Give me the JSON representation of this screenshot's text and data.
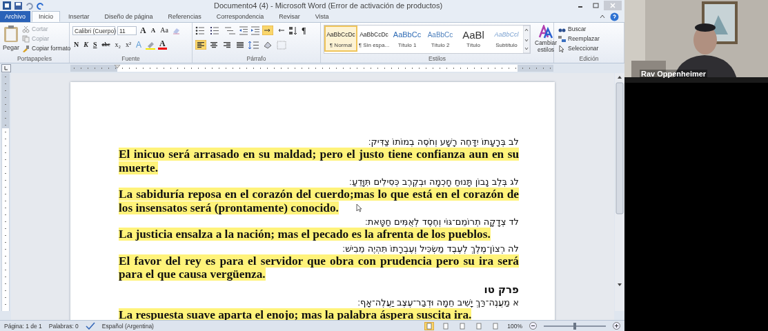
{
  "window": {
    "title": "Documento4 (4)  -  Microsoft Word (Error de activación de productos)"
  },
  "tabs": [
    {
      "label": "Archivo",
      "kind": "file",
      "selected": false
    },
    {
      "label": "Inicio",
      "kind": "tab",
      "selected": true
    },
    {
      "label": "Insertar",
      "kind": "tab",
      "selected": false
    },
    {
      "label": "Diseño de página",
      "kind": "tab",
      "selected": false
    },
    {
      "label": "Referencias",
      "kind": "tab",
      "selected": false
    },
    {
      "label": "Correspondencia",
      "kind": "tab",
      "selected": false
    },
    {
      "label": "Revisar",
      "kind": "tab",
      "selected": false
    },
    {
      "label": "Vista",
      "kind": "tab",
      "selected": false
    }
  ],
  "clipboard": {
    "label": "Portapapeles",
    "paste": "Pegar",
    "items": [
      {
        "label": "Cortar",
        "kind": "cut",
        "disabled": true
      },
      {
        "label": "Copiar",
        "kind": "copy",
        "disabled": true
      },
      {
        "label": "Copiar formato",
        "kind": "brush",
        "disabled": false
      }
    ]
  },
  "font": {
    "label": "Fuente",
    "name": "Calibri (Cuerpo)",
    "size": "11",
    "size_buttons": [
      {
        "label": "A",
        "kind": "grow"
      },
      {
        "label": "A",
        "kind": "shrink"
      },
      {
        "label": "Aa",
        "kind": "case"
      }
    ],
    "format_buttons": [
      {
        "label": "N",
        "kind": "bold"
      },
      {
        "label": "K",
        "kind": "italic"
      },
      {
        "label": "S",
        "kind": "underline"
      },
      {
        "label": "abc",
        "kind": "strike"
      },
      {
        "label": "x₂",
        "kind": "sub"
      },
      {
        "label": "x²",
        "kind": "sup"
      }
    ],
    "color_buttons": [
      {
        "label": "A",
        "kind": "effects"
      },
      {
        "label": "A",
        "kind": "color"
      }
    ]
  },
  "paragraph": {
    "label": "Párrafo",
    "directions": [
      {
        "kind": "ltr",
        "selected": true
      },
      {
        "kind": "rtl",
        "selected": false
      }
    ],
    "marks": {
      "label": "¶",
      "selected": false
    },
    "alignments": [
      {
        "kind": "left",
        "selected": true
      },
      {
        "kind": "center",
        "selected": false
      },
      {
        "kind": "right",
        "selected": false
      },
      {
        "kind": "justify",
        "selected": false
      }
    ]
  },
  "styles": {
    "label": "Estilos",
    "change": "Cambiar estilos",
    "items": [
      {
        "preview": "AaBbCcDc",
        "label": "¶ Normal",
        "kind": "normal",
        "selected": true
      },
      {
        "preview": "AaBbCcDc",
        "label": "¶ Sin espa...",
        "kind": "normal",
        "selected": false
      },
      {
        "preview": "AaBbCc",
        "label": "Título 1",
        "kind": "heading1",
        "selected": false
      },
      {
        "preview": "AaBbCc",
        "label": "Título 2",
        "kind": "heading2",
        "selected": false
      },
      {
        "preview": "AaBl",
        "label": "Título",
        "kind": "title",
        "selected": false
      },
      {
        "preview": "AaBbCcl",
        "label": "Subtítulo",
        "kind": "subtitle",
        "selected": false
      }
    ]
  },
  "editing": {
    "label": "Edición",
    "items": [
      {
        "label": "Buscar",
        "kind": "find"
      },
      {
        "label": "Reemplazar",
        "kind": "replace"
      },
      {
        "label": "Seleccionar",
        "kind": "select"
      }
    ]
  },
  "document": {
    "paragraphs": [
      {
        "kind": "hebrew",
        "text": "לב בְּרָעָתוֹ יִדָּחֶה רָשָׁע וְחֹסֶה בְמוֹתוֹ צַדִּיק׃"
      },
      {
        "kind": "spanish",
        "highlighted": true,
        "text": "El inicuo será arrasado en su maldad; pero el justo tiene confianza aun en su muerte."
      },
      {
        "kind": "hebrew",
        "text": "לג בְּלֵב נָבוֹן תָּנוּחַ חָכְמָה וּבְקֶרֶב כְּסִילִים תִּוָּדֵעַ׃"
      },
      {
        "kind": "spanish",
        "highlighted": true,
        "text": "La sabiduría reposa en el corazón del cuerdo;mas lo que está en el corazón de los insensatos será (prontamente)  conocido."
      },
      {
        "kind": "hebrew",
        "text": "לד צְדָקָה תְרוֹמֵם־גּוֹי וְחֶסֶד לְאֻמִּים חַטָּאת׃"
      },
      {
        "kind": "spanish",
        "highlighted": true,
        "text": "La justicia  ensalza a la nación; mas el pecado es la afrenta de los pueblos."
      },
      {
        "kind": "hebrew",
        "text": "לה רְצוֹן־מֶלֶךְ לְעֶבֶד מַשְׂכִּיל וְעֶבְרָתוֹ תִּהְיֶה מֵבִישׁ׃"
      },
      {
        "kind": "spanish",
        "highlighted": true,
        "text": "El favor del rey es para el servidor que obra con prudencia pero su ira será para el que causa vergüenza."
      },
      {
        "kind": "heading",
        "text": "פרק טו"
      },
      {
        "kind": "hebrew",
        "text": "א מַעֲנֶה־רַּךְ יָשִׁיב חֵמָה וּדְבַר־עֶצֶב יַעֲלֶה־אָף׃"
      },
      {
        "kind": "spanish",
        "highlighted": true,
        "text": "La respuesta  suave aparta el enojo; mas la palabra  áspera suscita ira."
      }
    ]
  },
  "status_bar": {
    "page": "Página: 1 de 1",
    "words": "Palabras: 0",
    "language": "Español (Argentina)",
    "views": [
      {
        "selected": true
      },
      {
        "selected": false
      },
      {
        "selected": false
      },
      {
        "selected": false
      },
      {
        "selected": false
      }
    ],
    "zoom": "100%",
    "zoom_slider": {
      "level": 0.5
    }
  },
  "video": {
    "name": "Rav Oppenheimer"
  }
}
